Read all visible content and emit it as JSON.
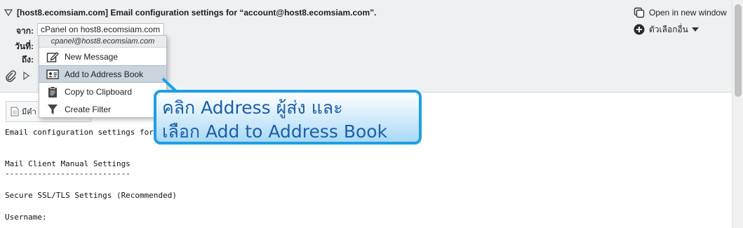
{
  "message": {
    "subject": "[host8.ecomsiam.com] Email configuration settings for “account@host8.ecomsiam.com”.",
    "labels": {
      "from": "จาก:",
      "date": "วันที่:",
      "to": "ถึง:"
    },
    "from_value": "cPanel on host8.ecomsiam.com"
  },
  "actions": {
    "open_new_window": "Open in new window",
    "more_options": "ตัวเลือกอื่น"
  },
  "context_menu": {
    "email": "cpanel@host8.ecomsiam.com",
    "items": [
      {
        "label": "New Message",
        "icon": "compose-icon"
      },
      {
        "label": "Add to Address Book",
        "icon": "address-book-icon",
        "active": true
      },
      {
        "label": "Copy to Clipboard",
        "icon": "clipboard-icon"
      },
      {
        "label": "Create Filter",
        "icon": "filter-icon"
      }
    ]
  },
  "body": {
    "tab_label": "มีคำ",
    "lines": [
      "Email configuration settings for",
      "Mail Client Manual Settings",
      "---------------------------",
      "Secure SSL/TLS Settings (Recommended)",
      "Username:"
    ]
  },
  "callout": {
    "line1": "คลิก Address ผู้ส่ง และ",
    "line2": "เลือก Add to Address Book"
  },
  "colors": {
    "callout_border": "#1e9fe3",
    "callout_text": "#1c5ea8",
    "header_bg": "#eef0f2",
    "menu_active": "#c9d4df"
  }
}
